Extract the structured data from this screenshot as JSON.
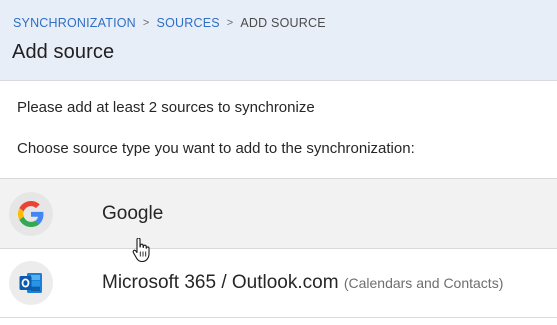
{
  "breadcrumb": {
    "items": [
      "SYNCHRONIZATION",
      "SOURCES",
      "ADD SOURCE"
    ],
    "separator": ">"
  },
  "header": {
    "title": "Add source"
  },
  "main": {
    "intro": "Please add at least 2 sources to synchronize",
    "instruction": "Choose source type you want to add to the synchronization:"
  },
  "sources": [
    {
      "label": "Google",
      "note": "",
      "icon": "google-icon",
      "hovered": true
    },
    {
      "label": "Microsoft 365 / Outlook.com",
      "note": "(Calendars and Contacts)",
      "icon": "outlook-icon",
      "hovered": false
    }
  ],
  "colors": {
    "header_bg": "#e8eef8",
    "link": "#2f6fc4",
    "row_hover": "#f2f2f2"
  }
}
